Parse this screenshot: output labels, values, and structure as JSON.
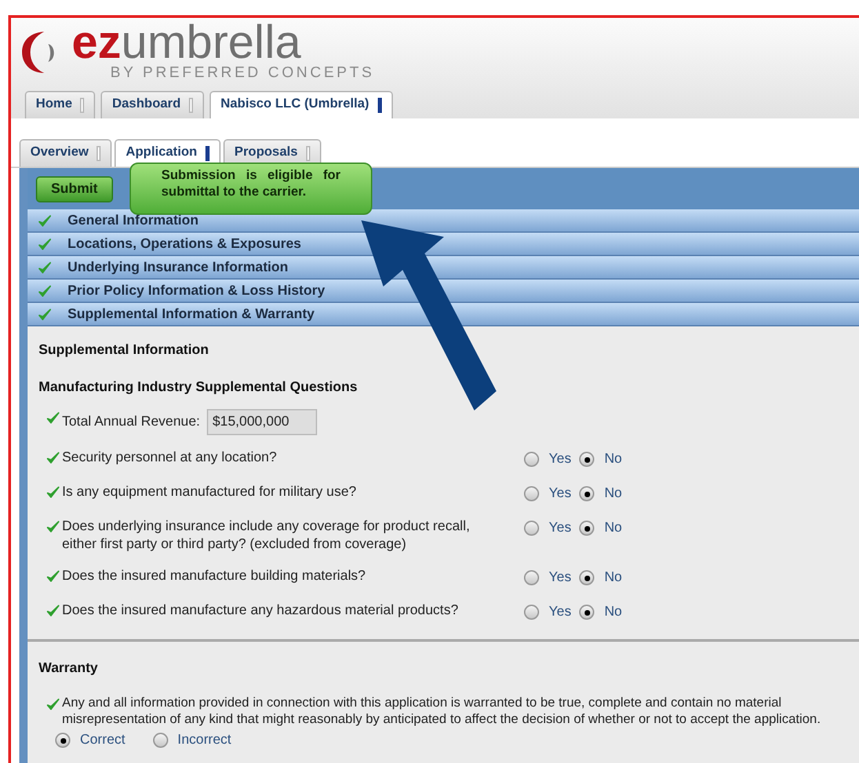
{
  "logo": {
    "brand_bold": "ez",
    "brand_rest": "umbrella",
    "tagline": "BY PREFERRED CONCEPTS"
  },
  "top_tabs": [
    {
      "label": "Home",
      "selected": false
    },
    {
      "label": "Dashboard",
      "selected": false
    },
    {
      "label": "Nabisco LLC (Umbrella)",
      "selected": true
    }
  ],
  "sub_tabs": [
    {
      "label": "Overview",
      "selected": false
    },
    {
      "label": "Application",
      "selected": true
    },
    {
      "label": "Proposals",
      "selected": false
    }
  ],
  "submit_button": "Submit",
  "tooltip": "Submission is eligible for submittal to the carrier.",
  "sections": [
    {
      "label": "General Information",
      "complete": true
    },
    {
      "label": "Locations, Operations & Exposures",
      "complete": true
    },
    {
      "label": "Underlying Insurance Information",
      "complete": true
    },
    {
      "label": "Prior Policy Information & Loss History",
      "complete": true
    },
    {
      "label": "Supplemental Information & Warranty",
      "complete": true
    }
  ],
  "supplemental": {
    "title": "Supplemental Information",
    "subtitle": "Manufacturing Industry Supplemental Questions",
    "questions": [
      {
        "kind": "text",
        "complete": true,
        "label": "Total Annual Revenue:",
        "value": "$15,000,000"
      },
      {
        "kind": "yes_no",
        "complete": true,
        "label": "Security personnel at any location?",
        "options": [
          {
            "label": "Yes",
            "selected": false
          },
          {
            "label": "No",
            "selected": true
          }
        ]
      },
      {
        "kind": "yes_no",
        "complete": true,
        "label": "Is any equipment manufactured for military use?",
        "options": [
          {
            "label": "Yes",
            "selected": false
          },
          {
            "label": "No",
            "selected": true
          }
        ]
      },
      {
        "kind": "yes_no",
        "complete": true,
        "label": "Does underlying insurance include any coverage for product recall, either first party or third party? (excluded from coverage)",
        "options": [
          {
            "label": "Yes",
            "selected": false
          },
          {
            "label": "No",
            "selected": true
          }
        ]
      },
      {
        "kind": "yes_no",
        "complete": true,
        "label": "Does the insured manufacture building materials?",
        "options": [
          {
            "label": "Yes",
            "selected": false
          },
          {
            "label": "No",
            "selected": true
          }
        ]
      },
      {
        "kind": "yes_no",
        "complete": true,
        "label": "Does the insured manufacture any hazardous material products?",
        "options": [
          {
            "label": "Yes",
            "selected": false
          },
          {
            "label": "No",
            "selected": true
          }
        ]
      }
    ]
  },
  "warranty": {
    "title": "Warranty",
    "complete": true,
    "statement": "Any and all information provided in connection with this application is warranted to be true, complete and contain no material misrepresentation of any kind that might reasonably by anticipated to affect the decision of whether or not to accept the application.",
    "options": [
      {
        "label": "Correct",
        "selected": true
      },
      {
        "label": "Incorrect",
        "selected": false
      }
    ]
  }
}
